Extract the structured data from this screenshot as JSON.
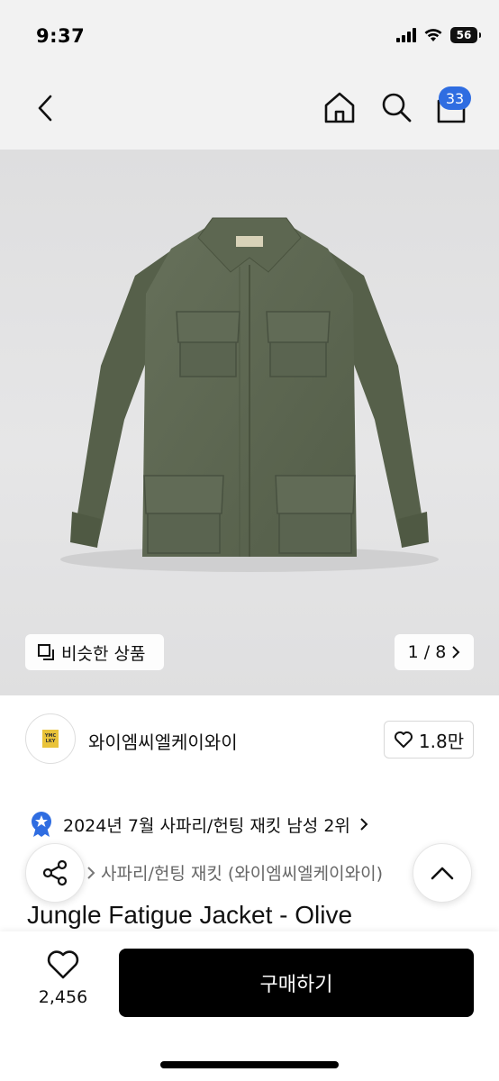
{
  "status_bar": {
    "time": "9:37",
    "battery": "56"
  },
  "nav": {
    "cart_count": "33",
    "icons": [
      "back-icon",
      "home-icon",
      "search-icon",
      "cart-icon"
    ]
  },
  "gallery": {
    "similar_label": "비슷한 상품",
    "pager": "1 / 8"
  },
  "brand": {
    "logo_text": "YMC LKY",
    "name": "와이엠씨엘케이와이",
    "likes": "1.8만"
  },
  "ranking": {
    "text": "2024년 7월 사파리/헌팅 재킷 남성 2위"
  },
  "breadcrumb": {
    "text": "사파리/헌팅 재킷 (와이엠씨엘케이와이)"
  },
  "product": {
    "title": "Jungle Fatigue Jacket - Olive"
  },
  "bottom": {
    "wish_count": "2,456",
    "buy_label": "구매하기"
  },
  "colors": {
    "badge": "#2f6de1",
    "jacket": "#5b6650",
    "buy_button": "#000000"
  }
}
